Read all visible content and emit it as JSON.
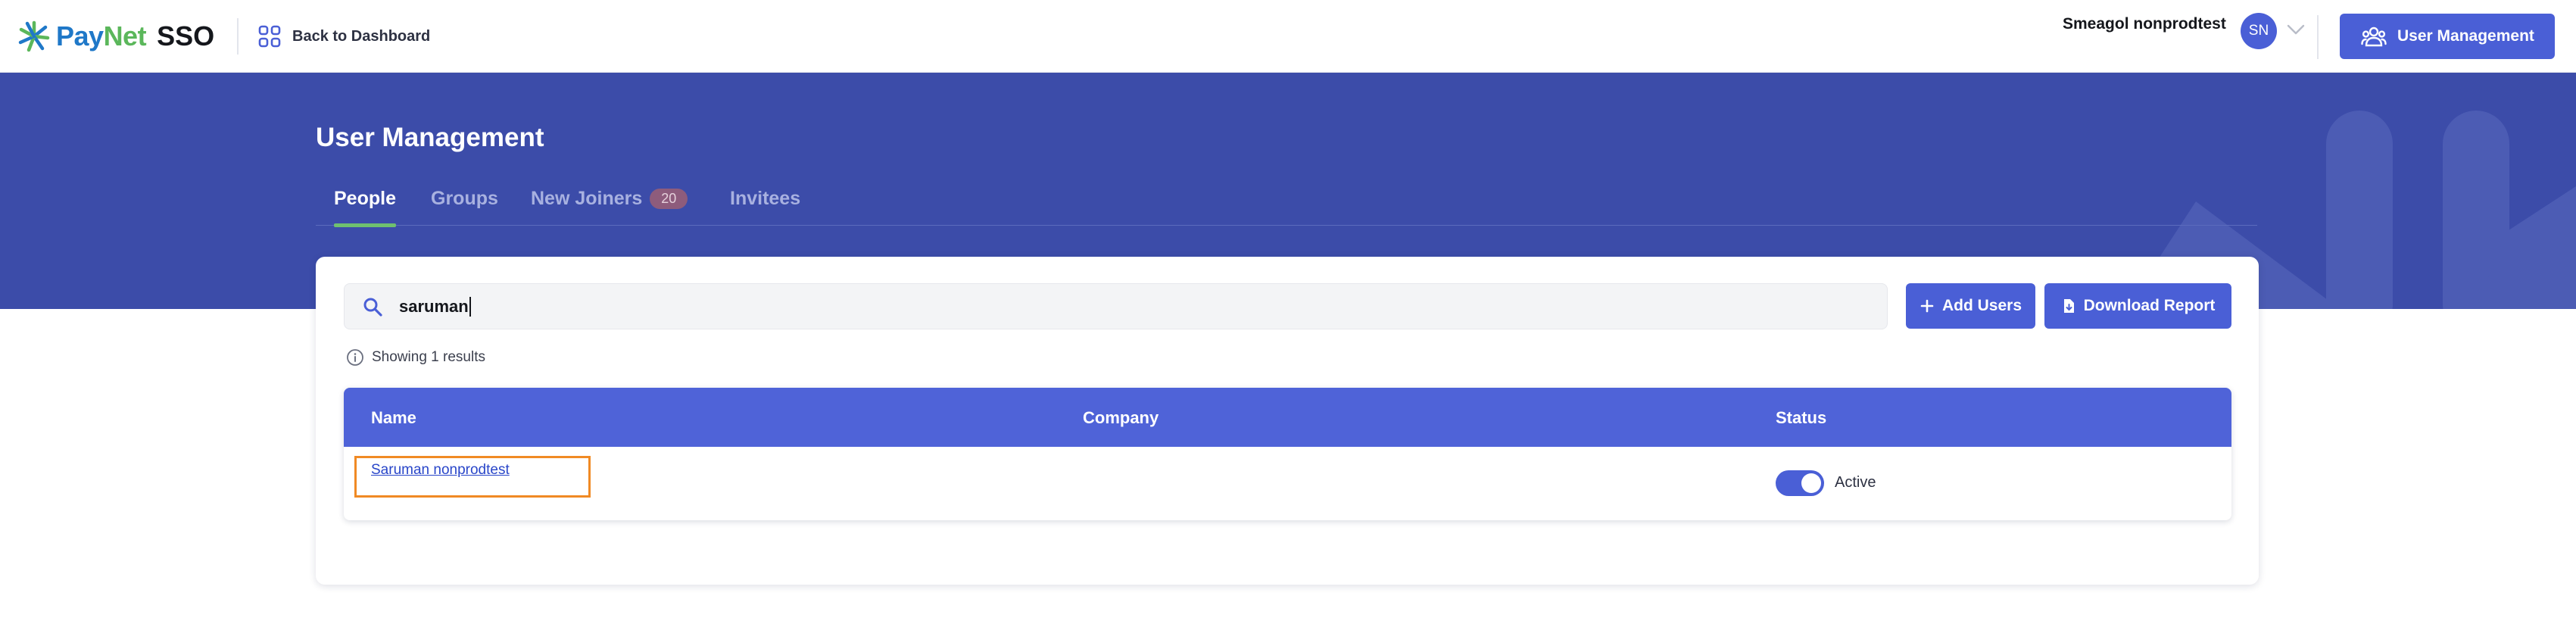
{
  "brand": {
    "pay": "Pay",
    "net": "Net",
    "sso": "SSO",
    "colors": {
      "blue": "#1f78c8",
      "green": "#5bb75b",
      "accent": "#4a5fd6",
      "hero": "#3c4ca9"
    }
  },
  "topbar": {
    "back_label": "Back to Dashboard",
    "back_icon": "grid-icon",
    "user_name": "Smeagol nonprodtest",
    "avatar_initials": "SN",
    "menu_button_label": "User Management",
    "menu_button_icon": "users-icon"
  },
  "page": {
    "title": "User Management",
    "tabs": [
      {
        "label": "People",
        "active": true
      },
      {
        "label": "Groups",
        "active": false
      },
      {
        "label": "New Joiners",
        "badge": "20",
        "active": false
      },
      {
        "label": "Invitees",
        "active": false
      }
    ]
  },
  "search": {
    "value": "saruman",
    "icon": "search-icon"
  },
  "actions": {
    "add_users": "Add Users",
    "download_report": "Download Report"
  },
  "results": {
    "text": "Showing 1 results"
  },
  "table": {
    "columns": [
      "Name",
      "Company",
      "Status"
    ],
    "rows": [
      {
        "name": "Saruman nonprodtest",
        "company": "",
        "status": "Active",
        "enabled": true
      }
    ]
  }
}
